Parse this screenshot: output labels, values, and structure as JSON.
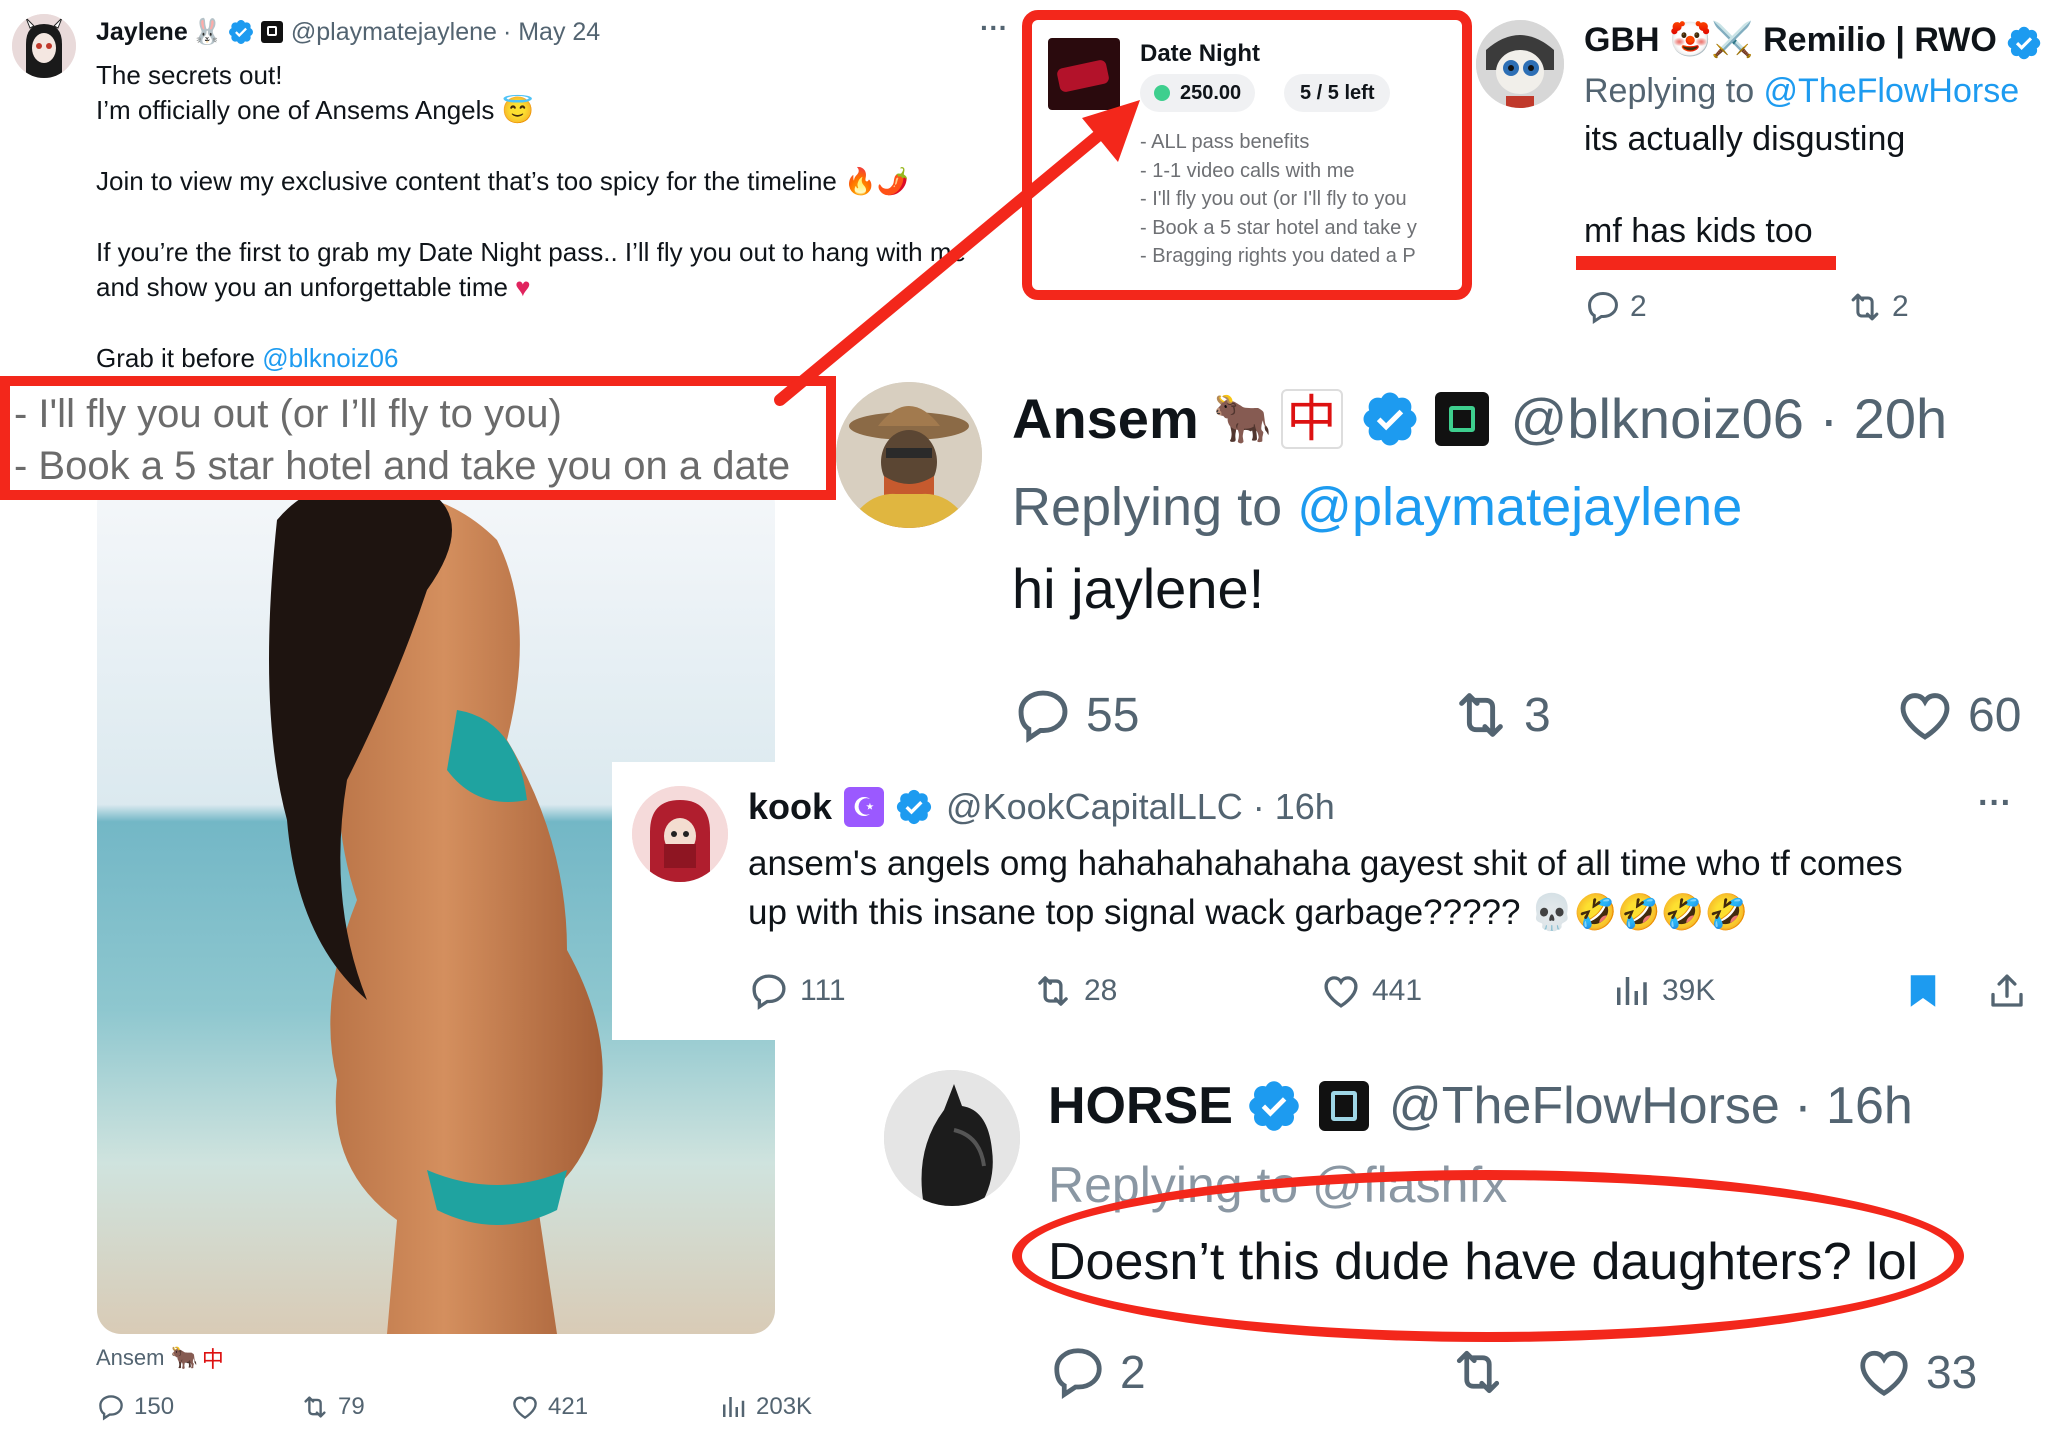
{
  "colors": {
    "accent": "#1d9bf0",
    "highlight": "#f3271b",
    "text": "#0f1419",
    "muted": "#536471"
  },
  "jaylene_tweet": {
    "name": "Jaylene",
    "handle": "@playmatejaylene",
    "date": "· May 24",
    "more": "···",
    "line1": "The secrets out!",
    "line2": "I’m officially one of Ansems Angels 😇",
    "line3": "Join to view my exclusive content that’s too spicy for the timeline 🔥🌶️",
    "line4": "If you’re the first to grab my Date Night pass.. I’ll fly you out to hang with me",
    "line5": "and show you an unforgettable time",
    "line6_prefix": "Grab it before ",
    "line6_mention": "@blknoiz06",
    "image_credit": "Ansem",
    "stats": {
      "replies": "150",
      "reposts": "79",
      "likes": "421",
      "views": "203K"
    }
  },
  "zoom_excerpt": {
    "line1": "- I'll fly you out (or I’ll fly to you)",
    "line2": "- Book a 5 star hotel and take you on a date"
  },
  "date_night_card": {
    "title": "Date Night",
    "price": "250.00",
    "availability": "5 / 5 left",
    "benefits": [
      "- ALL pass benefits",
      "- 1-1 video calls with me",
      "- I'll fly you out (or I'll fly to you",
      "- Book a 5 star hotel and take y",
      "- Bragging rights you dated a P"
    ]
  },
  "gbh_tweet": {
    "name": "GBH 🤡⚔️ Remilio | RWO",
    "replying_prefix": "Replying to ",
    "replying_handle": "@TheFlowHorse",
    "line1": "its actually disgusting",
    "line2": "mf has kids too",
    "stats": {
      "replies": "2",
      "reposts": "2"
    }
  },
  "ansem_tweet": {
    "name": "Ansem",
    "handle": "@blknoiz06 · 20h",
    "replying_prefix": "Replying to ",
    "replying_handle": "@playmatejaylene",
    "text": "hi jaylene!",
    "stats": {
      "replies": "55",
      "reposts": "3",
      "likes": "60"
    }
  },
  "kook_tweet": {
    "name": "kook",
    "handle": "@KookCapitalLLC · 16h",
    "more": "···",
    "line1": "ansem's angels omg hahahahahahaha gayest shit of all time who tf comes",
    "line2": "up with this insane top signal wack garbage????? 💀🤣🤣🤣🤣",
    "stats": {
      "replies": "111",
      "reposts": "28",
      "likes": "441",
      "views": "39K"
    }
  },
  "horse_tweet": {
    "name": "HORSE",
    "handle": "@TheFlowHorse · 16h",
    "replying_text": "Replying to @flashfx",
    "text": "Doesn’t this dude have daughters? lol",
    "stats": {
      "replies": "2",
      "likes": "33"
    }
  }
}
